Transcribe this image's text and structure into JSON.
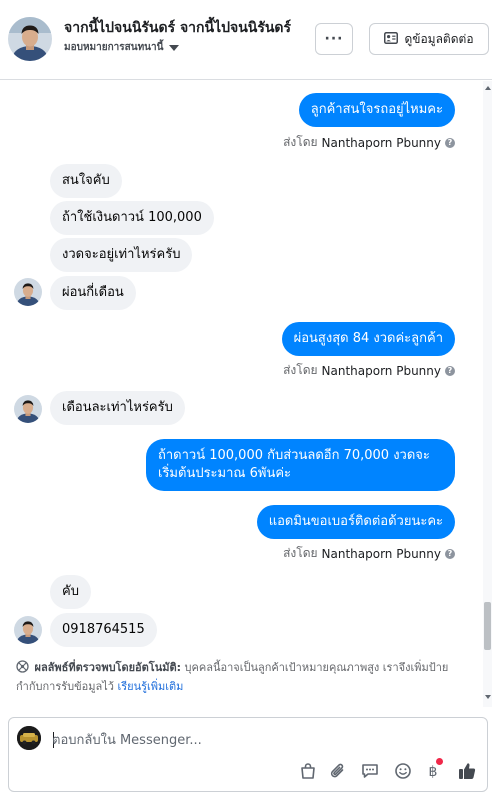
{
  "header": {
    "name": "จากนี้ไปจนนิรันดร์ จากนี้ไปจนนิรันดร์",
    "assignee": "มอบหมายการสนทนานี้",
    "more_label": "···",
    "contact_label": "ดูข้อมูลติดต่อ"
  },
  "messages": [
    {
      "dir": "out",
      "text": "ลูกค้าสนใจรถอยู่ไหมคะ"
    },
    {
      "dir": "meta",
      "prefix": "ส่งโดย",
      "name": "Nanthaporn Pbunny"
    },
    {
      "dir": "in",
      "text": "สนใจคับ"
    },
    {
      "dir": "in",
      "text": "ถ้าใช้เงินดาวน์ 100,000"
    },
    {
      "dir": "in",
      "text": "งวดจะอยู่เท่าไหร่ครับ"
    },
    {
      "dir": "in",
      "text": "ผ่อนกี่เดือน"
    },
    {
      "dir": "out",
      "text": "ผ่อนสูงสุด 84 งวดค่ะลูกค้า"
    },
    {
      "dir": "meta",
      "prefix": "ส่งโดย",
      "name": "Nanthaporn Pbunny"
    },
    {
      "dir": "in",
      "text": "เดือนละเท่าไหร่ครับ"
    },
    {
      "dir": "out",
      "line1": "ถ้าดาวน์ 100,000 กับส่วนลดอีก 70,000 งวดจะ",
      "line2": "เริ่มต้นประมาณ 6พันค่ะ"
    },
    {
      "dir": "out",
      "text": "แอดมินขอเบอร์ติดต่อด้วยนะคะ"
    },
    {
      "dir": "meta",
      "prefix": "ส่งโดย",
      "name": "Nanthaporn Pbunny"
    },
    {
      "dir": "in",
      "text": "คับ"
    },
    {
      "dir": "in",
      "text": "0918764515"
    }
  ],
  "notice": {
    "label": "ผลลัพธ์ที่ตรวจพบโดยอัตโนมัติ:",
    "body": "บุคคลนี้อาจเป็นลูกค้าเป้าหมายคุณภาพสูง เราจึงเพิ่มป้ายกำกับการรับข้อมูลไว้",
    "link": "เรียนรู้เพิ่มเติม"
  },
  "composer": {
    "placeholder": "ตอบกลับใน Messenger..."
  },
  "toolbar_icons": [
    "shopping-bag-icon",
    "paperclip-icon",
    "saved-replies-icon",
    "emoji-icon",
    "currency-icon",
    "thumbs-up-icon"
  ],
  "colors": {
    "outgoing_bubble": "#0084ff",
    "incoming_bubble": "#f0f2f5",
    "link": "#216fdb",
    "notification_dot": "#f02849"
  }
}
